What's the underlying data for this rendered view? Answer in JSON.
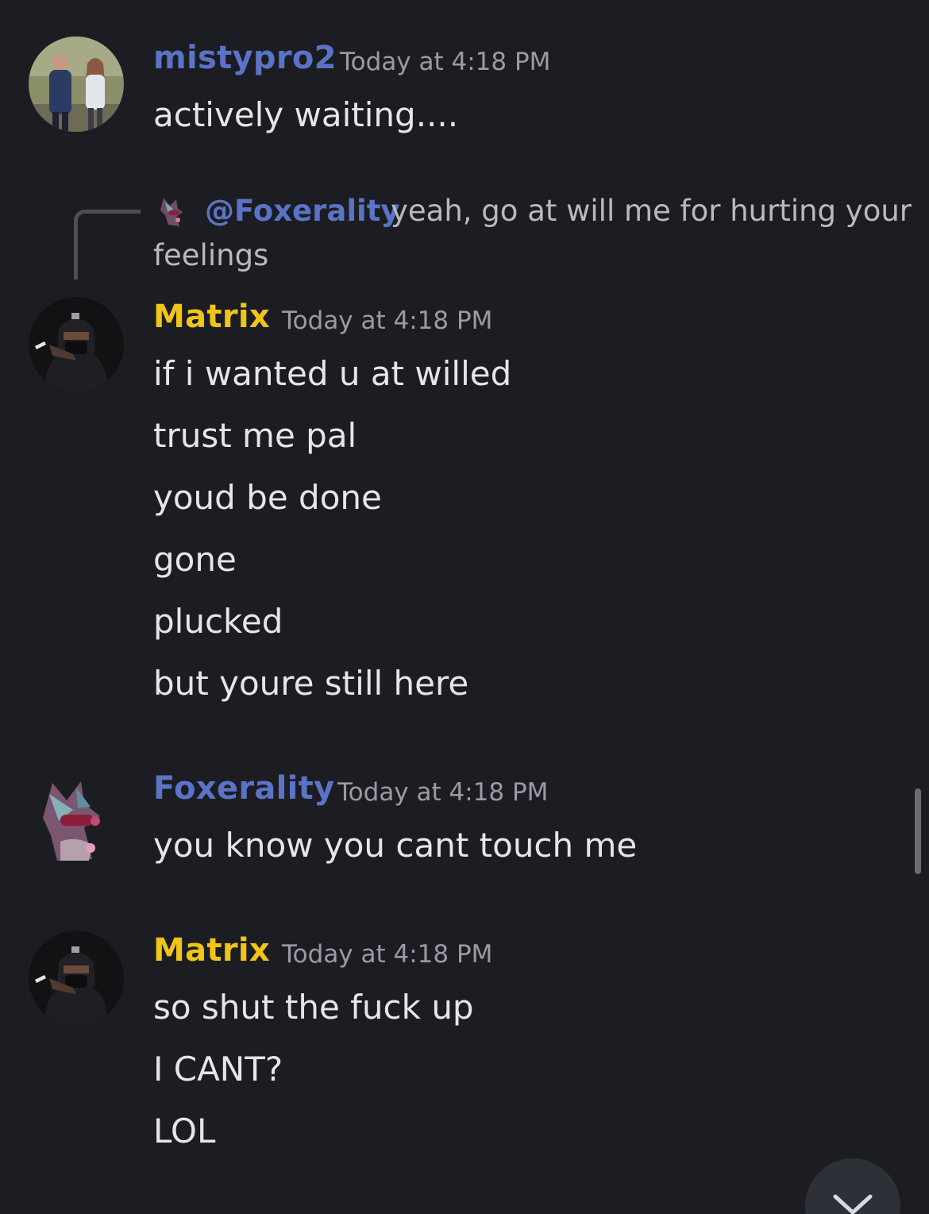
{
  "colors": {
    "background": "#1c1d22",
    "blurple_name": "#5b73c7",
    "gold_name": "#f0c419",
    "message_text": "#e6e6ea",
    "timestamp_text": "#9a9ba4"
  },
  "messages": [
    {
      "author": "mistypro2",
      "timestamp": "Today at 4:18 PM",
      "avatar_icon": "couple-photo-avatar",
      "lines": [
        "actively waiting...."
      ]
    },
    {
      "reply": {
        "author": "@Foxerality",
        "text_line1": "yeah, go at will me for hurting your",
        "text_line2": "feelings",
        "avatar_icon": "fox-avatar"
      },
      "author": "Matrix",
      "timestamp": "Today at 4:18 PM",
      "avatar_icon": "masked-person-avatar",
      "lines": [
        "if i wanted u at willed",
        "trust me pal",
        "youd be done",
        "gone",
        "plucked",
        "but youre still here"
      ]
    },
    {
      "author": "Foxerality",
      "timestamp": "Today at 4:18 PM",
      "avatar_icon": "fox-avatar",
      "lines": [
        "you know you cant touch me"
      ]
    },
    {
      "author": "Matrix",
      "timestamp": "Today at 4:18 PM",
      "avatar_icon": "masked-person-avatar",
      "lines": [
        "so shut the fuck up",
        "I CANT?",
        "LOL"
      ]
    }
  ],
  "controls": {
    "jump_to_present_icon": "chevron-down-icon"
  }
}
